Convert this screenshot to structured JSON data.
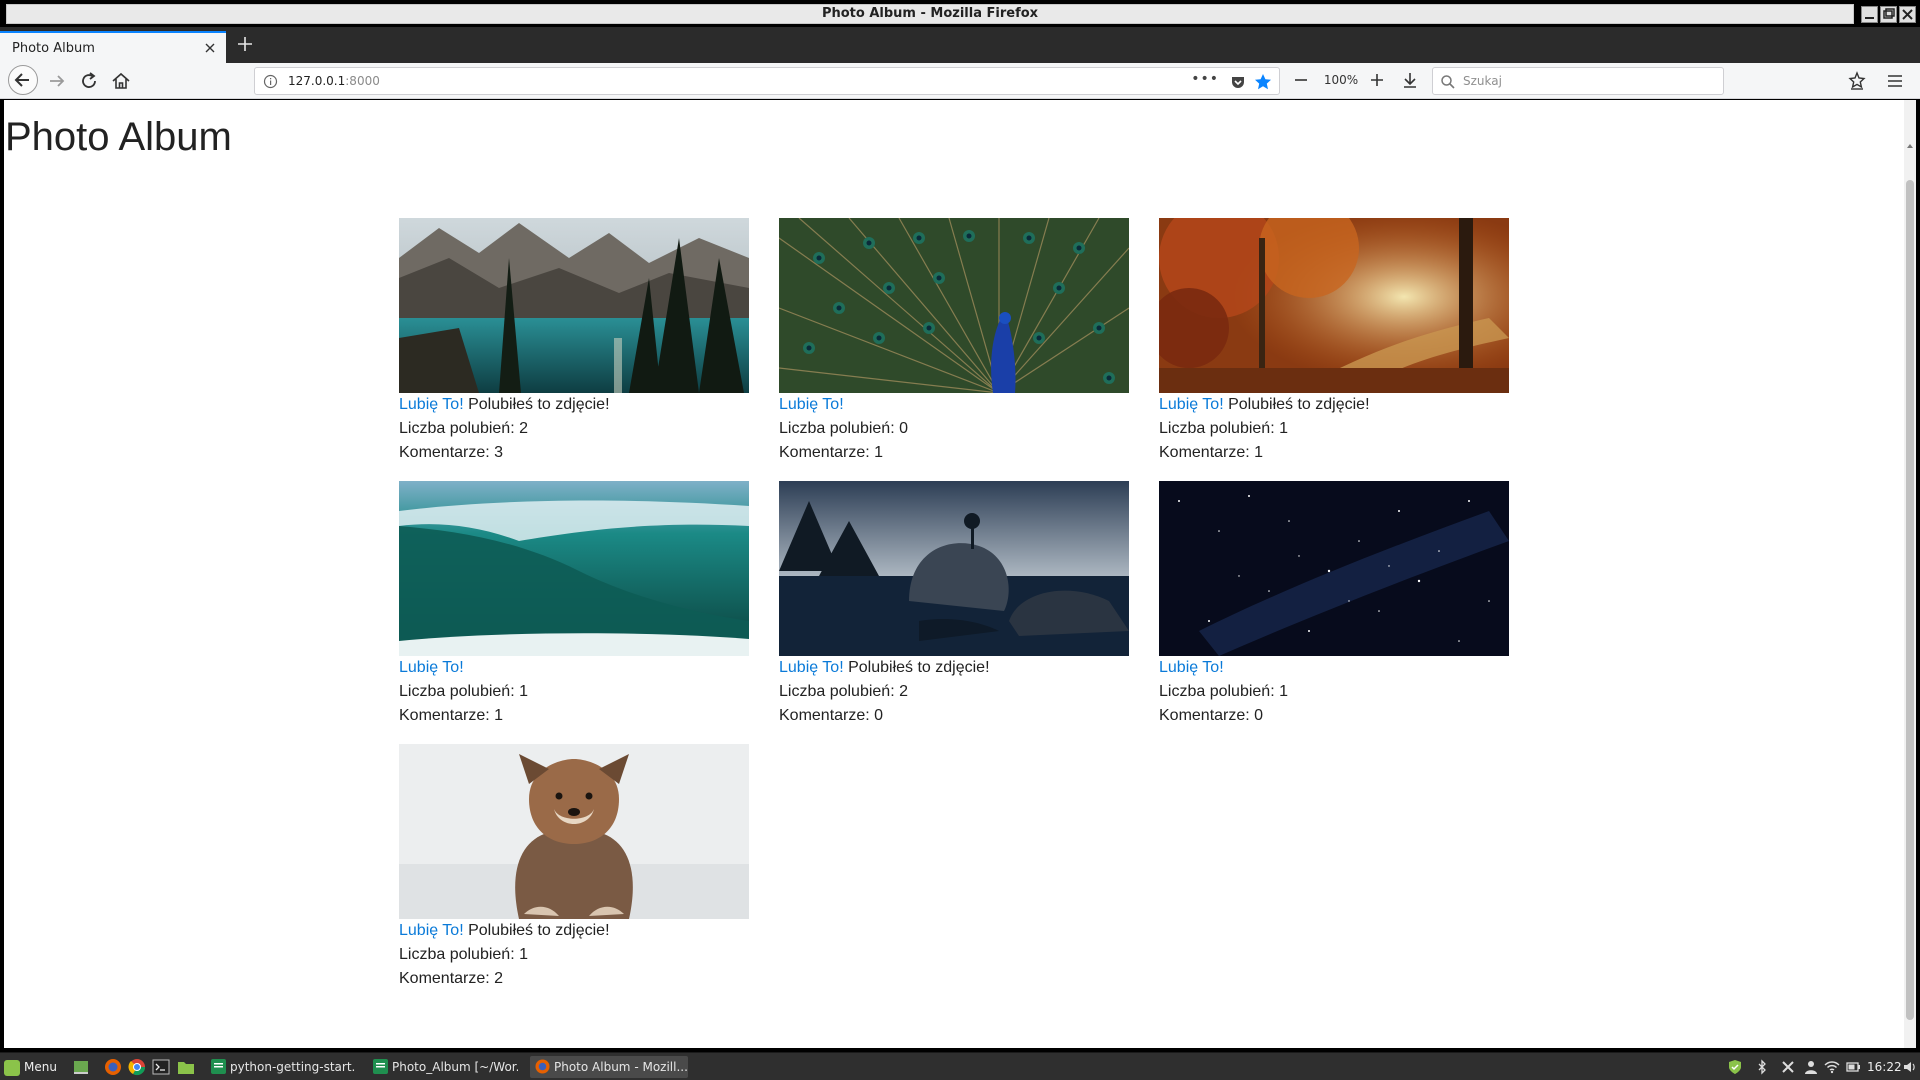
{
  "window": {
    "title": "Photo Album - Mozilla Firefox"
  },
  "tabs": [
    {
      "label": "Photo Album"
    }
  ],
  "navbar": {
    "url_host": "127.0.0.1",
    "url_port": ":8000",
    "zoom": "100%",
    "search_placeholder": "Szukaj"
  },
  "page": {
    "title": "Photo Album",
    "photos": [
      {
        "image": "mountain-lake-photo",
        "like_link": "Lubię To!",
        "liked_text": "Polubiłeś to zdjęcie!",
        "likes_label": "Liczba polubień: 2",
        "comments_label": "Komentarze: 3"
      },
      {
        "image": "peacock-photo",
        "like_link": "Lubię To!",
        "liked_text": "",
        "likes_label": "Liczba polubień: 0",
        "comments_label": "Komentarze: 1"
      },
      {
        "image": "autumn-forest-photo",
        "like_link": "Lubię To!",
        "liked_text": "Polubiłeś to zdjęcie!",
        "likes_label": "Liczba polubień: 1",
        "comments_label": "Komentarze: 1"
      },
      {
        "image": "ocean-wave-photo",
        "like_link": "Lubię To!",
        "liked_text": "",
        "likes_label": "Liczba polubień: 1",
        "comments_label": "Komentarze: 1"
      },
      {
        "image": "lake-rock-photo",
        "like_link": "Lubię To!",
        "liked_text": "Polubiłeś to zdjęcie!",
        "likes_label": "Liczba polubień: 2",
        "comments_label": "Komentarze: 0"
      },
      {
        "image": "starry-sky-photo",
        "like_link": "Lubię To!",
        "liked_text": "",
        "likes_label": "Liczba polubień: 1",
        "comments_label": "Komentarze: 0"
      },
      {
        "image": "puppy-photo",
        "like_link": "Lubię To!",
        "liked_text": "Polubiłeś to zdjęcie!",
        "likes_label": "Liczba polubień: 1",
        "comments_label": "Komentarze: 2"
      }
    ]
  },
  "taskbar": {
    "menu_label": "Menu",
    "tasks": [
      {
        "label": "python-getting-start..."
      },
      {
        "label": "Photo_Album [~/Wor..."
      },
      {
        "label": "Photo Album - Mozill..."
      }
    ],
    "clock": "16:22"
  },
  "colors": {
    "link": "#0a7ad8",
    "accent": "#0a84ff"
  }
}
